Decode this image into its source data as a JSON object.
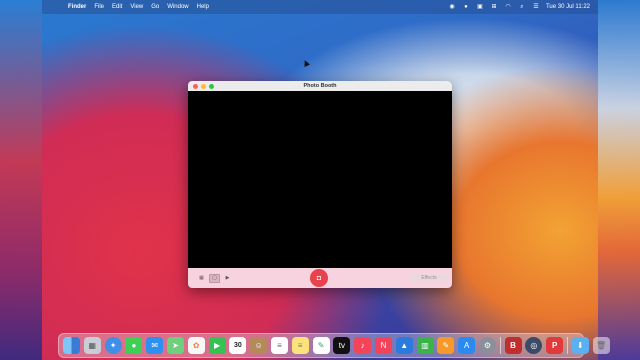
{
  "menubar": {
    "app": "Finder",
    "items": [
      "File",
      "Edit",
      "View",
      "Go",
      "Window",
      "Help"
    ],
    "clock": "Tue 30 Jul  11:22"
  },
  "window": {
    "title": "Photo Booth",
    "effects_label": "Effects"
  },
  "dock": {
    "calendar_day": "30",
    "apps": [
      "finder",
      "launchpad",
      "safari",
      "messages",
      "mail",
      "maps",
      "photos",
      "facetime",
      "calendar",
      "contacts",
      "reminders",
      "notes",
      "freeform",
      "apple-tv",
      "music",
      "news",
      "keynote",
      "numbers",
      "pages",
      "app-store",
      "system-preferences",
      "bbedit",
      "quicktime",
      "parallels",
      "downloads",
      "trash"
    ]
  },
  "colors": {
    "shutter": "#e8424c",
    "photobooth_bar": "#f6d3de"
  }
}
